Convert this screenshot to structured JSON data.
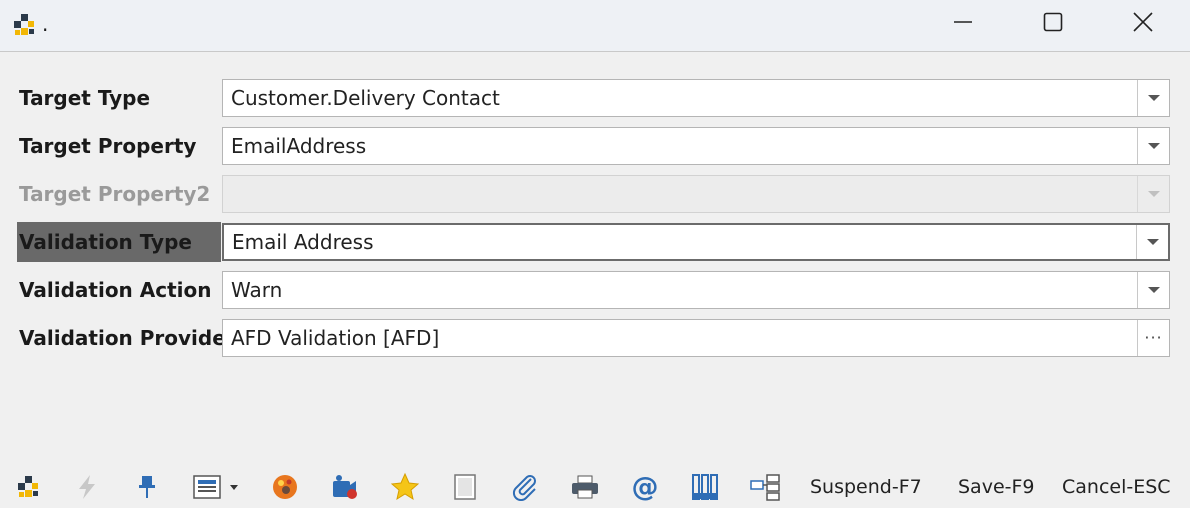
{
  "window": {
    "title": ".",
    "icons": [
      "app-logo-icon",
      "minimize-icon",
      "maximize-icon",
      "close-icon"
    ]
  },
  "form": {
    "fields": [
      {
        "label": "Target Type",
        "value": "Customer.Delivery Contact",
        "control": "dropdown",
        "enabled": true
      },
      {
        "label": "Target Property",
        "value": "EmailAddress",
        "control": "dropdown",
        "enabled": true
      },
      {
        "label": "Target Property2",
        "value": "",
        "control": "dropdown",
        "enabled": false
      },
      {
        "label": "Validation Type",
        "value": "Email Address",
        "control": "dropdown",
        "enabled": true,
        "focused": true
      },
      {
        "label": "Validation Action",
        "value": "Warn",
        "control": "dropdown",
        "enabled": true
      },
      {
        "label": "Validation Provider",
        "value": "AFD Validation [AFD]",
        "control": "ellipsis-button",
        "enabled": true
      }
    ],
    "ellipsis_label": "···"
  },
  "toolbar": {
    "icons": [
      "app-logo-icon",
      "lightning-icon",
      "pin-icon",
      "layout-dropdown-icon",
      "palette-icon",
      "record-icon",
      "star-icon",
      "notes-icon",
      "paperclip-icon",
      "print-icon",
      "email-icon",
      "columns-icon",
      "hierarchy-icon"
    ],
    "suspend_label": "Suspend-F7",
    "save_label": "Save-F9",
    "cancel_label": "Cancel-ESC"
  },
  "colors": {
    "accent_yellow": "#f2b705",
    "logo_dark": "#2b3a4a",
    "highlight_label_bg": "#696969",
    "toolbar_blue": "#2f6db5"
  }
}
